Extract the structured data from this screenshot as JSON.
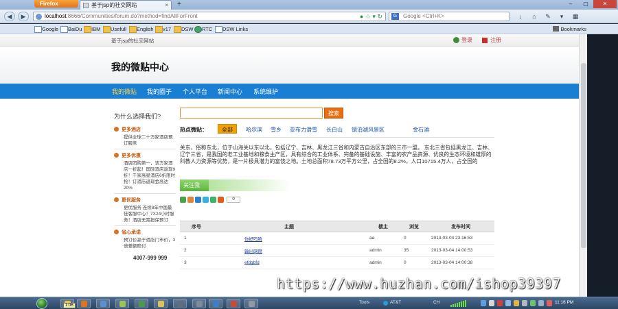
{
  "browser": {
    "firefox_label": "Firefox",
    "tab_title": "基于jsp的社交网站",
    "tab_close": "×",
    "new_tab": "+",
    "win_min": "–",
    "win_max": "▢",
    "win_close": "✕",
    "url_host": "localhost",
    "url_rest": ":8666/Communities/forum.do?method=findAllForFront",
    "search_placeholder": "Google <Ctrl+K>",
    "bookmarks": [
      "Google",
      "BaiDu",
      "IBM",
      "Usefull",
      "English",
      "v17",
      "DSW",
      "RTC",
      "DSW Links"
    ],
    "bookmarks_right": "Bookmarks"
  },
  "site": {
    "name": "基于jsp的社交网站",
    "login": "登录",
    "register": "注册",
    "title": "我的微贴中心"
  },
  "nav": [
    "我的微贴",
    "我的圈子",
    "个人平台",
    "新闻中心",
    "系统维护"
  ],
  "sidebar": {
    "title": "为什么选择我们?",
    "sections": [
      {
        "head": "更多酒店",
        "text": "提供全球二十万家酒店预订服务"
      },
      {
        "head": "更多优惠",
        "text": "酒店团购第一，该方家酒店一折起！国际酒店返现9折！千家高星酒店6折限时抢！订酒店返现金高达20%"
      },
      {
        "head": "更优服务",
        "text": "更优服务 连续8年中国最佳客服中心！7X24小时服务！酒店无需担保预订"
      },
      {
        "head": "省心承诺",
        "text": "预订价高于酒店门市价，3倍差额赔付"
      }
    ],
    "phone": "4007-999 999"
  },
  "content": {
    "search_button": "搜索",
    "hot_label": "热点微贴：",
    "hot_tags": [
      "全部",
      "哈尔滨",
      "雪乡",
      "亚布力滑雪",
      "长白山",
      "镜泊湖风景区",
      "金石滩"
    ],
    "description": "关东，俗称东北，位于山海关以东以北，包括辽宁、吉林、黑龙江三省和内蒙古自治区东部的三市一盟。 东北三省包括黑龙江、吉林、辽宁三省，是我国的老工业基地和粮食主产区，具有综合的工业体系、完备的基础设施、丰富的农产品资源、优良的生态环境和雄厚的科教人力资源等优势，是一片极具潜力的富饶之地。土地总面积78.73万平方公里，占全国的8.2%，人口10715.4万人，占全国的",
    "follow_button": "关注我",
    "share_count": "0",
    "table": {
      "headers": [
        "序号",
        "主题",
        "楼主",
        "浏览",
        "发布时间"
      ],
      "rows": [
        [
          "1",
          "你好吗哈",
          "aa",
          "0",
          "2013-03-04 23:16:53"
        ],
        [
          "2",
          "输出网度",
          "admin",
          "35",
          "2013-03-04 14:00:53"
        ],
        [
          "3",
          "efdgbfd",
          "admin",
          "0",
          "2013-03-04 14:00:38"
        ]
      ]
    }
  },
  "watermark": "https://www.huzhan.com/ishop39397",
  "taskbar": {
    "badge": "1:06",
    "tray_tools": "Tools",
    "tray_att": "AT&T",
    "tray_ch": "CH",
    "clock": "11:16 PM"
  }
}
